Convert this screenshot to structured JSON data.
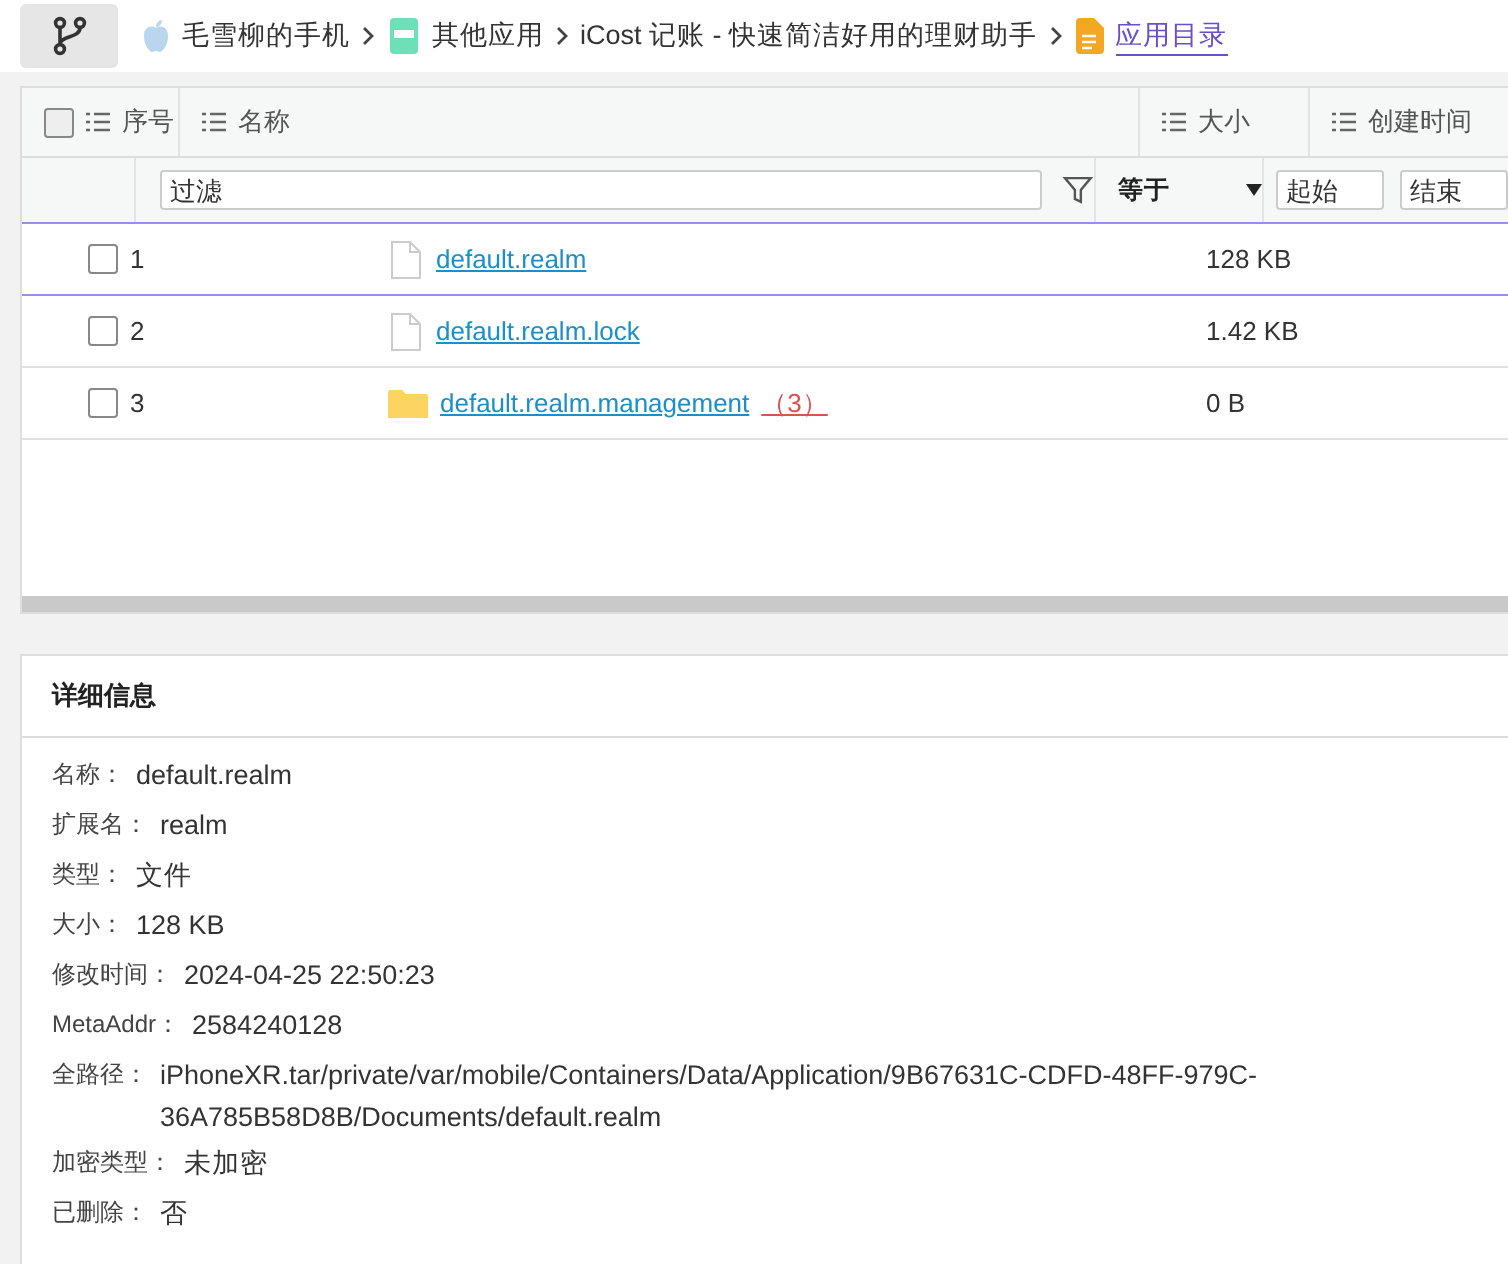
{
  "breadcrumb": [
    {
      "label": "毛雪柳的手机",
      "kind": "apple",
      "current": false
    },
    {
      "label": "其他应用",
      "kind": "app",
      "current": false
    },
    {
      "label": "iCost 记账 - 快速简洁好用的理财助手",
      "kind": "none",
      "current": false
    },
    {
      "label": "应用目录",
      "kind": "doc",
      "current": true
    }
  ],
  "table": {
    "select_all": {
      "checked": false
    },
    "columns": [
      {
        "label": "序号"
      },
      {
        "label": "名称"
      },
      {
        "label": "大小"
      },
      {
        "label": "创建时间"
      }
    ],
    "filter": {
      "placeholder": "过滤",
      "operator": "等于",
      "start_placeholder": "起始",
      "end_placeholder": "结束"
    },
    "rows": [
      {
        "index": "1",
        "name": "default.realm",
        "kind": "file",
        "size": "128 KB",
        "checked": false,
        "selected": true
      },
      {
        "index": "2",
        "name": "default.realm.lock",
        "kind": "file",
        "size": "1.42 KB",
        "checked": false,
        "selected": false
      },
      {
        "index": "3",
        "name": "default.realm.management",
        "kind": "folder",
        "count": "（3）",
        "size": "0 B",
        "checked": false,
        "selected": false
      }
    ]
  },
  "details": {
    "title": "详细信息",
    "fields": [
      {
        "label": "名称：",
        "value": "default.realm"
      },
      {
        "label": "扩展名：",
        "value": "realm"
      },
      {
        "label": "类型：",
        "value": "文件"
      },
      {
        "label": "大小：",
        "value": "128 KB"
      },
      {
        "label": "修改时间：",
        "value": "2024-04-25 22:50:23"
      },
      {
        "label": "MetaAddr：",
        "value": "2584240128"
      },
      {
        "label": "全路径：",
        "value": "iPhoneXR.tar/private/var/mobile/Containers/Data/Application/9B67631C-CDFD-48FF-979C-36A785B58D8B/Documents/default.realm"
      },
      {
        "label": "加密类型：",
        "value": "未加密"
      },
      {
        "label": "已删除：",
        "value": "否"
      }
    ]
  }
}
